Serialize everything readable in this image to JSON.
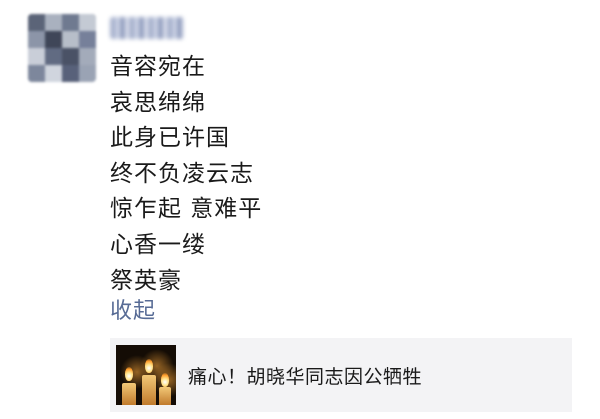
{
  "post": {
    "poem_lines": [
      "音容宛在",
      "哀思绵绵",
      "此身已许国",
      "终不负凌云志",
      "惊乍起 意难平",
      "心香一缕",
      "祭英豪"
    ],
    "collapse_label": "收起"
  },
  "shared_article": {
    "title": "痛心！胡晓华同志因公牺牲",
    "thumbnail_icon": "candles-image"
  },
  "colors": {
    "link": "#576b95",
    "text": "#1a1a1a",
    "card_background": "#f3f3f5"
  }
}
